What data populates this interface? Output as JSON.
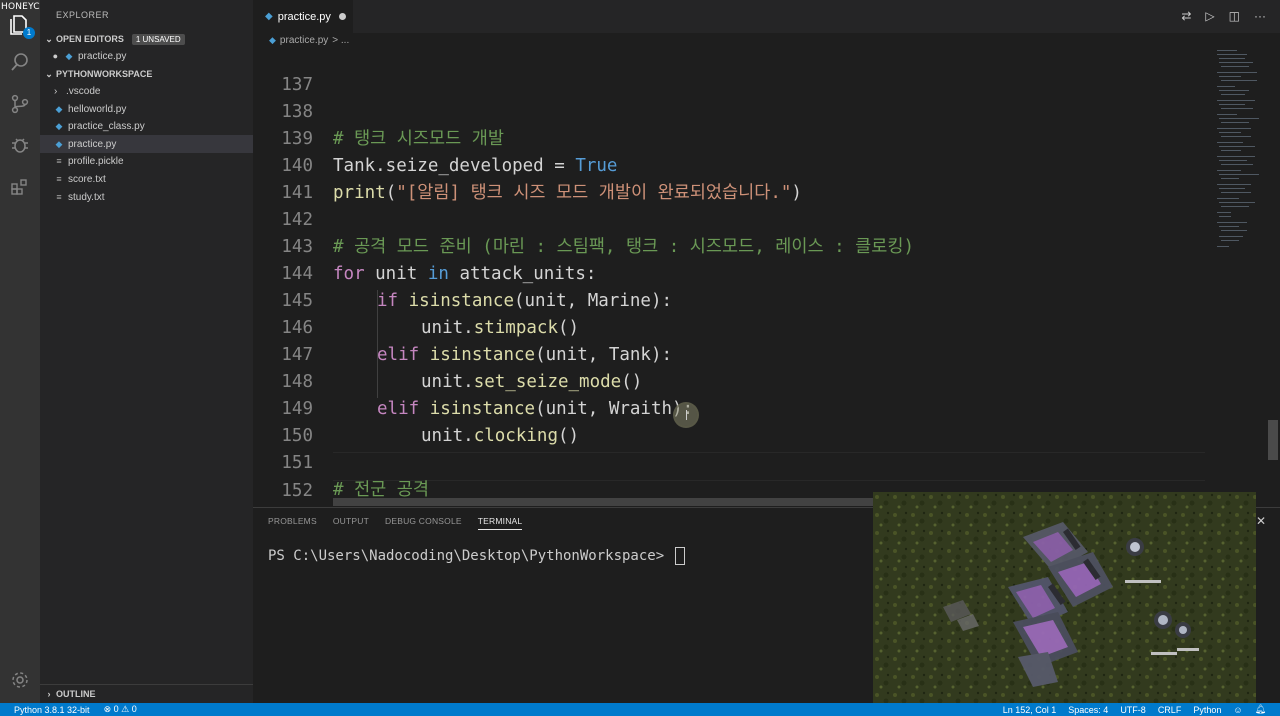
{
  "watermark": "HONEYCAM",
  "activity_bar": {
    "explorer_badge": "1"
  },
  "sidebar": {
    "title": "EXPLORER",
    "open_editors": {
      "label": "OPEN EDITORS",
      "unsaved": "1 UNSAVED",
      "files": [
        "practice.py"
      ]
    },
    "workspace": {
      "label": "PYTHONWORKSPACE",
      "items": [
        {
          "name": ".vscode",
          "type": "folder"
        },
        {
          "name": "helloworld.py",
          "type": "py"
        },
        {
          "name": "practice_class.py",
          "type": "py"
        },
        {
          "name": "practice.py",
          "type": "py"
        },
        {
          "name": "profile.pickle",
          "type": "txt"
        },
        {
          "name": "score.txt",
          "type": "txt"
        },
        {
          "name": "study.txt",
          "type": "txt"
        }
      ]
    },
    "outline_label": "OUTLINE"
  },
  "tab": {
    "filename": "practice.py"
  },
  "breadcrumb": {
    "file": "practice.py",
    "rest": "> ..."
  },
  "editor": {
    "line_numbers": [
      "137",
      "138",
      "139",
      "140",
      "141",
      "142",
      "143",
      "144",
      "145",
      "146",
      "147",
      "148",
      "149",
      "150",
      "151",
      "152"
    ],
    "lines": {
      "l138": "# 탱크 시즈모드 개발",
      "l139_a": "Tank.seize_developed = ",
      "l139_b": "True",
      "l140_a": "print",
      "l140_b": "(",
      "l140_c": "\"[알림] 탱크 시즈 모드 개발이 완료되었습니다.\"",
      "l140_d": ")",
      "l142": "# 공격 모드 준비 (마린 : 스팀팩, 탱크 : 시즈모드, 레이스 : 클로킹)",
      "l143_for": "for",
      "l143_mid": " unit ",
      "l143_in": "in",
      "l143_end": " attack_units:",
      "l144_if": "if",
      "l144_fn": "isinstance",
      "l144_end": "(unit, Marine):",
      "l145_a": "unit.",
      "l145_b": "stimpack",
      "l145_c": "()",
      "l146_elif": "elif",
      "l146_fn": "isinstance",
      "l146_end": "(unit, Tank):",
      "l147_a": "unit.",
      "l147_b": "set_seize_mode",
      "l147_c": "()",
      "l148_elif": "elif",
      "l148_fn": "isinstance",
      "l148_end": "(unit, Wraith):",
      "l149_a": "unit.",
      "l149_b": "clocking",
      "l149_c": "()",
      "l151": "# 전군 공격"
    }
  },
  "panel": {
    "tabs": [
      "PROBLEMS",
      "OUTPUT",
      "DEBUG CONSOLE",
      "TERMINAL"
    ],
    "active_tab": "TERMINAL",
    "prompt": "PS C:\\Users\\Nadocoding\\Desktop\\PythonWorkspace> "
  },
  "status_bar": {
    "interpreter": "Python 3.8.1 32-bit",
    "errors": "0",
    "warnings": "0",
    "position": "Ln 152, Col 1",
    "spaces": "Spaces: 4",
    "encoding": "UTF-8",
    "eol": "CRLF",
    "language": "Python"
  },
  "colors": {
    "accent": "#007acc",
    "comment": "#6a9955",
    "keyword": "#c586c0",
    "builtin": "#569cd6",
    "function": "#dcdcaa",
    "string": "#ce9178"
  }
}
